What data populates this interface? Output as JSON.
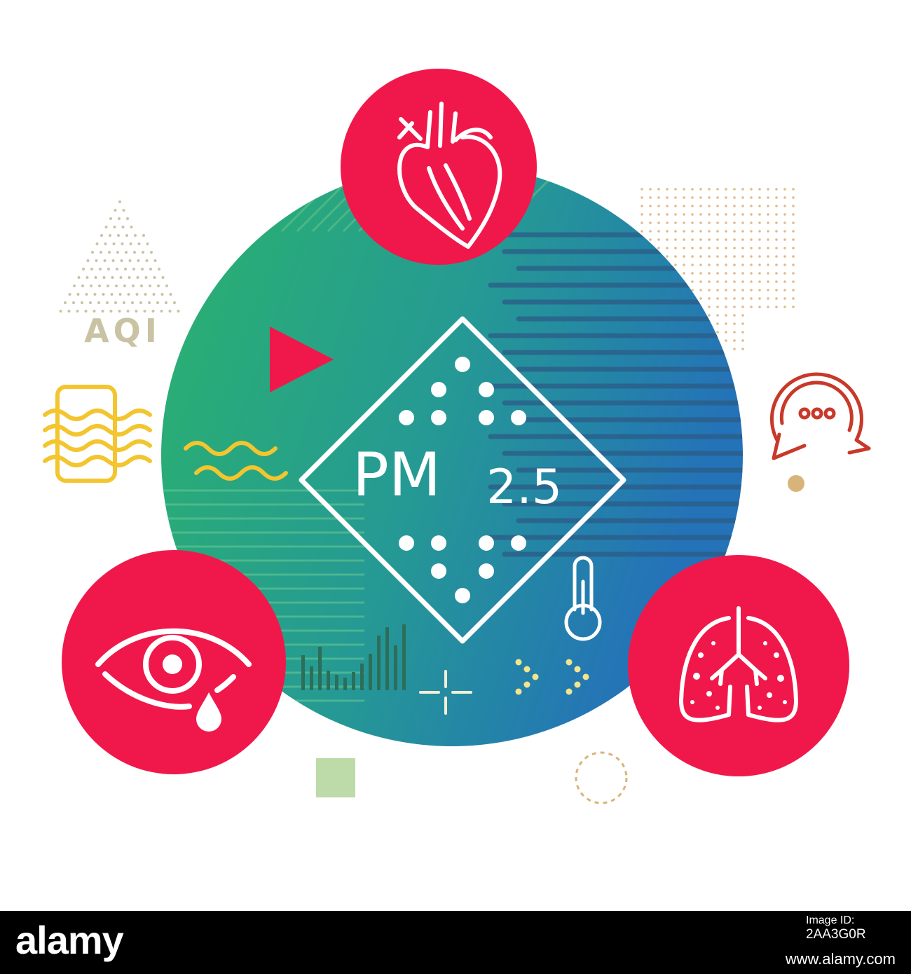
{
  "labels": {
    "aqi": "AQI",
    "pm_main": "PM",
    "pm_sub": "2.5"
  },
  "colors": {
    "red": "#F0184A",
    "green": "#2BB36C",
    "blue": "#2472B8",
    "yellow": "#F3C52E",
    "brown": "#C8392A",
    "sand": "#D9B47A",
    "khaki": "#C9C3A4",
    "square": "#BDDBA9"
  },
  "icons": [
    "heart-icon",
    "eye-tear-icon",
    "lungs-icon",
    "thermometer-icon",
    "chat-bubble-icon",
    "document-waves-icon"
  ],
  "footer": {
    "logo": "alamy",
    "image_id_label": "Image ID:",
    "image_id": "2AA3G0R",
    "url": "www.alamy.com"
  }
}
